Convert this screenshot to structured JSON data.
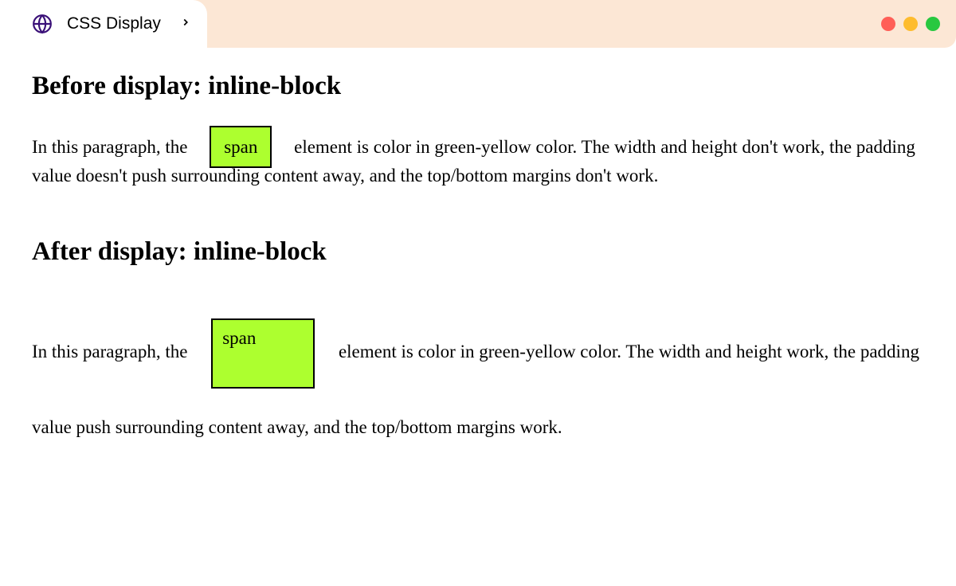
{
  "browser": {
    "tab_title": "CSS Display"
  },
  "section1": {
    "heading": "Before display: inline-block",
    "text_before": "In this paragraph, the ",
    "span_text": "span",
    "text_after": " element is color in green-yellow color. The width and height don't work, the padding value doesn't push surrounding content away, and the top/bottom margins don't work."
  },
  "section2": {
    "heading": "After display: inline-block",
    "text_before": "In this paragraph, the ",
    "span_text": "span",
    "text_after": " element is color in green-yellow color. The width and height work, the padding value push surrounding content away, and the top/bottom margins work."
  },
  "colors": {
    "span_bg": "#adff2f",
    "browser_bar": "#fce7d5"
  }
}
